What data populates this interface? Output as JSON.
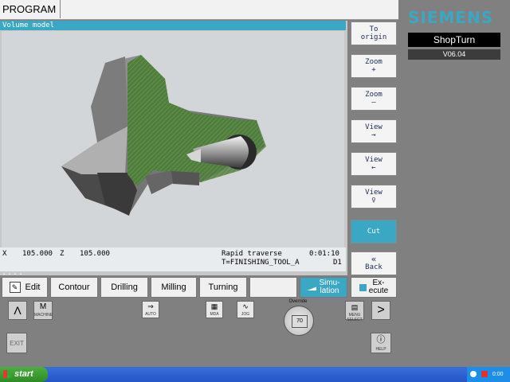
{
  "title_cell": "PROGRAM",
  "view": {
    "header": "Volume model"
  },
  "status": {
    "x_label": "X",
    "x_value": "105.000",
    "z_label": "Z",
    "z_value": "105.000",
    "mode": "Rapid traverse",
    "time": "0:01:10",
    "tool": "T=FINISHING_TOOL_A",
    "d": "D1"
  },
  "dots": "....",
  "vertical_softkeys": [
    "To\norigin",
    "Zoom\n+",
    "Zoom\n–",
    "View\n→",
    "View\n←",
    "View\n♀",
    "Cut",
    "Back"
  ],
  "back_icon": "double-chevron-left-icon",
  "brand": {
    "logo": "SIEMENS",
    "product": "ShopTurn",
    "version": "V06.04"
  },
  "bottom_softkeys": {
    "edit": "Edit",
    "contour": "Contour",
    "drilling": "Drilling",
    "milling": "Milling",
    "turning": "Turning",
    "blank": "",
    "simulation": "Simu-\nlation",
    "execute": "Ex-\necute"
  },
  "machine_panel": {
    "up_key": "Λ",
    "right_key": ">",
    "exit": "EXIT",
    "override_label": "Override",
    "override_value": "70",
    "machine_caption": "MACHINE",
    "auto_caption": "AUTO",
    "mda_caption": "MDA",
    "jog_caption": "JOG",
    "menu_caption": "MENU SELECT",
    "help_caption": "HELP"
  },
  "taskbar": {
    "start": "start",
    "clock": "0:00"
  },
  "colors": {
    "accent": "#3aa7c4",
    "panel_bg": "#808080",
    "part_gray": "#8a8a8a",
    "cut_green": "#4a7a3a"
  }
}
